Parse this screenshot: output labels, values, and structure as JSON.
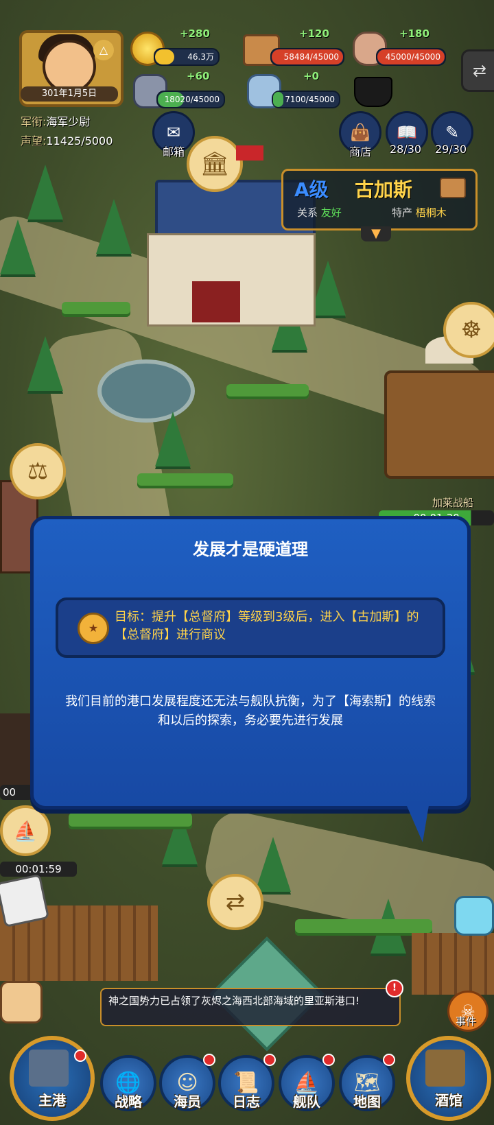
{
  "player": {
    "date": "301年1月5日",
    "rank_label": "军衔:",
    "rank_value": "海军少尉",
    "fame_label": "声望:",
    "fame_value": "11425/5000"
  },
  "resources": [
    {
      "id": "gold",
      "gain": "+280",
      "value": "46.3万",
      "fill": 0.3,
      "color": "#f2c12e"
    },
    {
      "id": "wood",
      "gain": "+120",
      "value": "58484/45000",
      "fill": 1.0,
      "color": "#d64028"
    },
    {
      "id": "stone",
      "gain": "+180",
      "value": "45000/45000",
      "fill": 1.0,
      "color": "#d64028"
    },
    {
      "id": "iron",
      "gain": "+60",
      "value": "18020/45000",
      "fill": 0.4,
      "color": "#4caf50"
    },
    {
      "id": "crystal",
      "gain": "+0",
      "value": "7100/45000",
      "fill": 0.16,
      "color": "#4caf50"
    }
  ],
  "right_menu": {
    "mail": "邮箱",
    "shop": "商店",
    "academy_count": "28/30",
    "crew_count": "29/30"
  },
  "city": {
    "grade": "A级",
    "name": "古加斯",
    "relation_label": "关系",
    "relation_value": "友好",
    "specialty_label": "特产",
    "specialty_value": "梧桐木"
  },
  "map_labels": {
    "shipyard": "加莱战船",
    "shipyard_timer": "00:01:30",
    "left_timer": "00:01:59",
    "left_timer_partial": "00"
  },
  "dialog": {
    "title": "发展才是硬道理",
    "goal": "目标：提升【总督府】等级到3级后，进入【古加斯】的【总督府】进行商议",
    "body": "我们目前的港口发展程度还无法与舰队抗衡，为了【海索斯】的线索和以后的探索，务必要先进行发展"
  },
  "news": "神之国势力已占领了灰烬之海西北部海域的里亚斯港口!",
  "event_label": "事件",
  "nav": {
    "home": "主港",
    "strategy": "战略",
    "crew": "海员",
    "log": "日志",
    "fleet": "舰队",
    "map": "地图",
    "tavern": "酒馆"
  },
  "colors": {
    "dialog_bg": "#1f5fc2",
    "goal_text": "#ffd34a",
    "gain_text": "#8ff07a",
    "relation_good": "#5fe25a"
  }
}
